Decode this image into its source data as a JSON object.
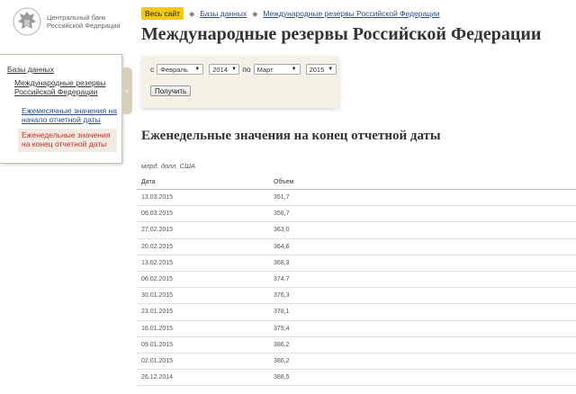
{
  "logo": {
    "line1": "Центральный банк",
    "line2": "Российской Федерации"
  },
  "breadcrumb": {
    "all_site": "Весь сайт",
    "items": [
      "Базы данных",
      "Международные резервы Российской Федерации"
    ]
  },
  "page_title": "Международные резервы Российской Федерации",
  "sidebar": {
    "root": "Базы данных",
    "db": "Международные резервы Российской Федерации",
    "monthly": "Ежемесячные значения на начало отчетной даты",
    "weekly": "Еженедельные значения на конец отчетной даты"
  },
  "filter": {
    "from_label": "с",
    "to_label": "по",
    "from_month": "Февраль",
    "from_year": "2014",
    "to_month": "Март",
    "to_year": "2015",
    "submit": "Получить"
  },
  "section_title": "Еженедельные значения на конец отчетной даты",
  "units": "млрд. долл. США",
  "table": {
    "headers": [
      "Дата",
      "Объем"
    ],
    "rows": [
      [
        "13.03.2015",
        "351,7"
      ],
      [
        "06.03.2015",
        "356,7"
      ],
      [
        "27.02.2015",
        "363,0"
      ],
      [
        "20.02.2015",
        "364,6"
      ],
      [
        "13.02.2015",
        "368,3"
      ],
      [
        "06.02.2015",
        "374,7"
      ],
      [
        "30.01.2015",
        "376,3"
      ],
      [
        "23.01.2015",
        "378,1"
      ],
      [
        "16.01.2015",
        "379,4"
      ],
      [
        "09.01.2015",
        "386,2"
      ],
      [
        "02.01.2015",
        "386,2"
      ],
      [
        "26.12.2014",
        "388,5"
      ]
    ]
  },
  "colors": {
    "accent": "#f3c81b",
    "link": "#2a4d8f",
    "active": "#c0322a",
    "panel": "#f4f1e6"
  }
}
